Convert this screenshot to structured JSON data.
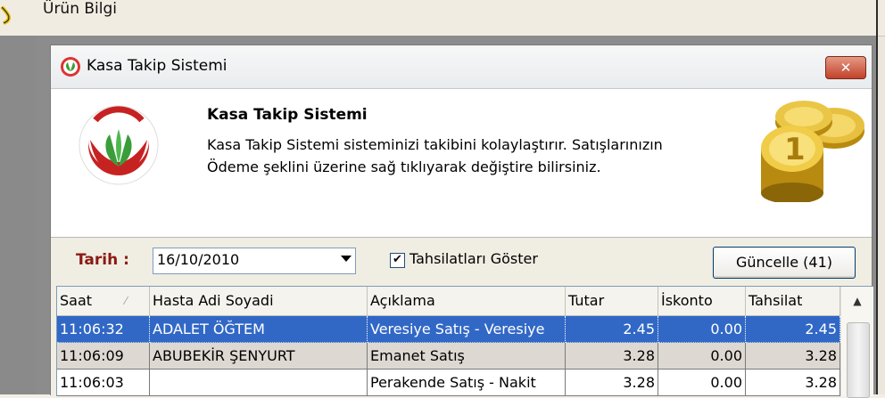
{
  "background_app": {
    "title": "Ürün Bilgi"
  },
  "window": {
    "title": "Kasa Takip Sistemi",
    "close_label": "✕"
  },
  "header": {
    "title": "Kasa Takip Sistemi",
    "desc_line1": "Kasa Takip Sistemi sisteminizi takibini kolaylaştırır. Satışlarınızın",
    "desc_line2": "Ödeme şeklini üzerine sağ tıklıyarak değiştire bilirsiniz."
  },
  "toolbar": {
    "tarih_label": "Tarih :",
    "date_value": "16/10/2010",
    "show_collections_label": "Tahsilatları Göster",
    "show_collections_checked": "✔",
    "refresh_label": "Güncelle (41)"
  },
  "grid": {
    "columns": [
      "Saat",
      "Hasta Adi Soyadi",
      "Açıklama",
      "Tutar",
      "İskonto",
      "Tahsilat"
    ],
    "sort_indicator": "⁄",
    "rows": [
      {
        "saat": "11:06:32",
        "hasta": "ADALET ÖĞTEM",
        "aciklama": "Veresiye Satış - Veresiye",
        "tutar": "2.45",
        "iskonto": "0.00",
        "tahsilat": "2.45"
      },
      {
        "saat": "11:06:09",
        "hasta": "ABUBEKİR ŞENYURT",
        "aciklama": "Emanet Satış",
        "tutar": "3.28",
        "iskonto": "0.00",
        "tahsilat": "3.28"
      },
      {
        "saat": "11:06:03",
        "hasta": "",
        "aciklama": "Perakende Satış - Nakit",
        "tutar": "3.28",
        "iskonto": "0.00",
        "tahsilat": "3.28"
      }
    ],
    "scroll_up": "▲"
  },
  "colors": {
    "selection": "#3168c6",
    "tarih_label": "#8b1a12",
    "close_button": "#c2412a"
  }
}
